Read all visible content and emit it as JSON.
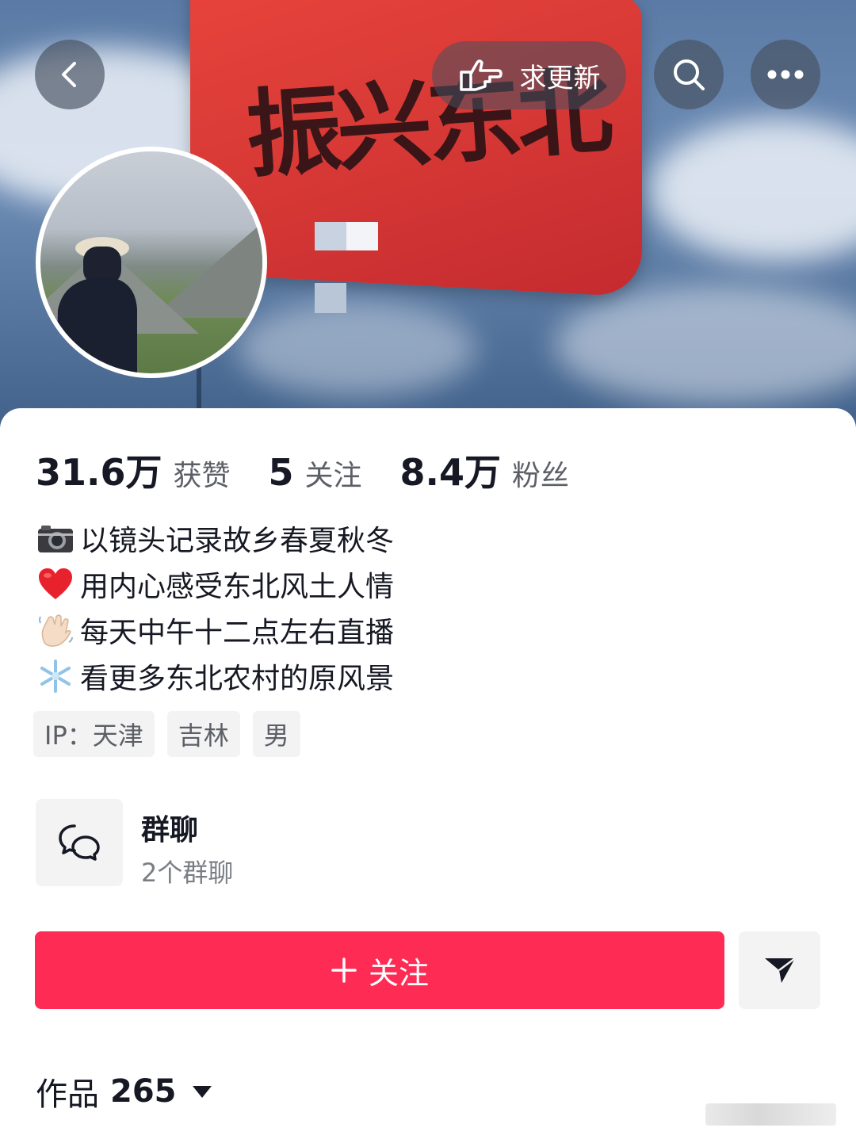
{
  "header": {
    "banner_flag_text": "振兴东北",
    "request_update_label": "求更新",
    "icons": [
      "back-icon",
      "hand-point-icon",
      "search-icon",
      "more-icon"
    ]
  },
  "stats": [
    {
      "value": "31.6万",
      "label": "获赞"
    },
    {
      "value": "5",
      "label": "关注"
    },
    {
      "value": "8.4万",
      "label": "粉丝"
    }
  ],
  "bio": [
    {
      "icon": "camera-emoji",
      "text": "以镜头记录故乡春夏秋冬"
    },
    {
      "icon": "heart-emoji",
      "text": "用内心感受东北风土人情"
    },
    {
      "icon": "waving-hand-emoji",
      "text": "每天中午十二点左右直播"
    },
    {
      "icon": "snowflake-emoji",
      "text": "看更多东北农村的原风景"
    }
  ],
  "tags": [
    "IP：天津",
    "吉林",
    "男"
  ],
  "group_chat": {
    "title": "群聊",
    "subtitle": "2个群聊",
    "icon": "chat-bubbles-icon"
  },
  "actions": {
    "follow_label": "关注",
    "follow_icon": "plus-icon",
    "share_icon": "send-icon"
  },
  "works": {
    "label": "作品",
    "count": "265"
  },
  "colors": {
    "accent": "#fe2c55",
    "text": "#161823",
    "muted": "#5c5f66",
    "chip_bg": "#f3f3f4"
  }
}
